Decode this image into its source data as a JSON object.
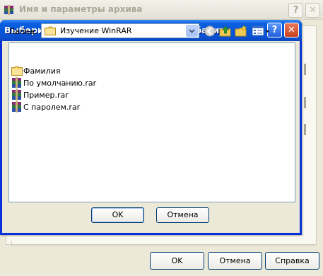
{
  "background_window": {
    "title": "Имя и параметры архива",
    "buttons": {
      "ok": "OK",
      "cancel": "Отмена",
      "help": "Справка"
    }
  },
  "dialog": {
    "title": "Выберите файлы, которые нужно добавить",
    "look_in_label": "Папка:",
    "current_folder": "Изучение WinRAR",
    "toolbar_icons": [
      "back-icon",
      "up-folder-icon",
      "new-folder-icon",
      "view-menu-icon"
    ],
    "files": [
      {
        "name": "Фамилия",
        "type": "folder"
      },
      {
        "name": "По умолчанию.rar",
        "type": "rar"
      },
      {
        "name": "Пример.rar",
        "type": "rar"
      },
      {
        "name": "С паролем.rar",
        "type": "rar"
      }
    ],
    "buttons": {
      "ok": "OK",
      "cancel": "Отмена"
    },
    "caption_buttons": {
      "help": "?",
      "close": "✕"
    }
  },
  "colors": {
    "titlebar_blue": "#0556d8",
    "dialog_face": "#ece9d8",
    "list_border": "#7f9db9"
  }
}
